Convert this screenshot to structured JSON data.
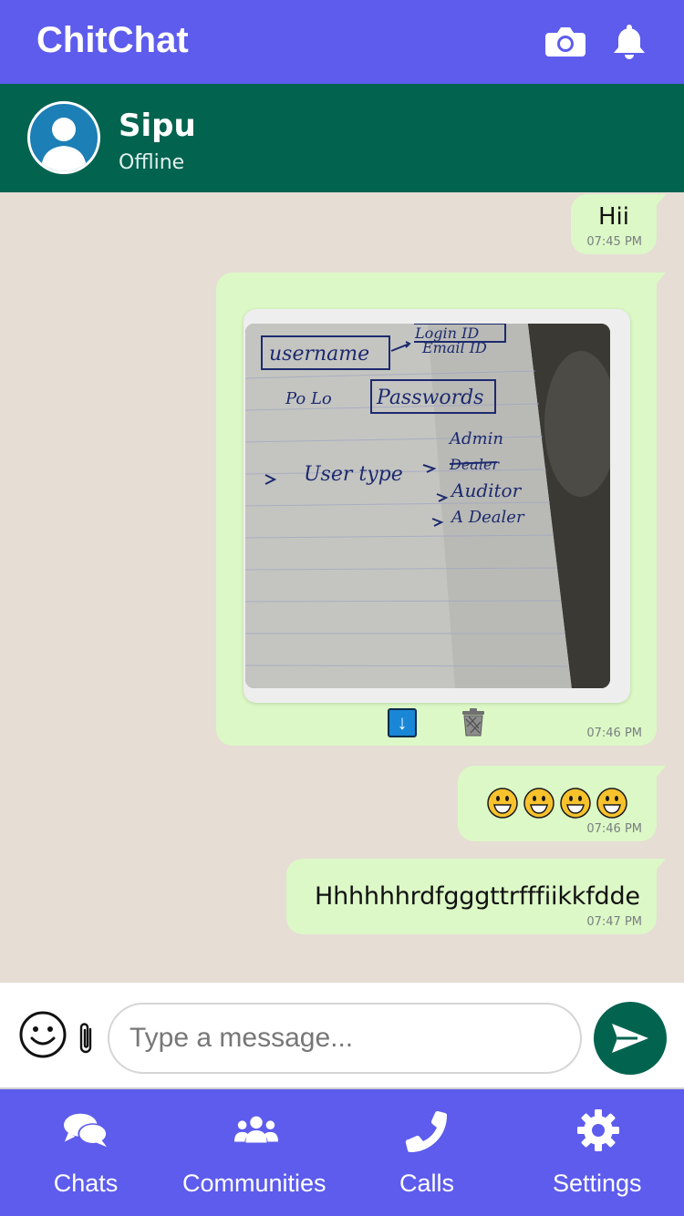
{
  "app": {
    "title": "ChitChat"
  },
  "topbar": {
    "icons": [
      "camera-icon",
      "bell-icon"
    ]
  },
  "contact": {
    "name": "Sipu",
    "status": "Offline"
  },
  "messages": [
    {
      "type": "text",
      "text": "Hii",
      "time": "07:45 PM"
    },
    {
      "type": "image",
      "time": "07:46 PM",
      "actions": [
        "download-icon",
        "trash-icon"
      ],
      "download_glyph": "↓"
    },
    {
      "type": "emoji",
      "emoji_count": 4,
      "time": "07:46 PM"
    },
    {
      "type": "text",
      "text": "Hhhhhhrdfgggttrfffiikkfdde",
      "time": "07:47 PM"
    }
  ],
  "composer": {
    "placeholder": "Type a message...",
    "value": ""
  },
  "nav": {
    "items": [
      {
        "label": "Chats",
        "icon": "chats-icon"
      },
      {
        "label": "Communities",
        "icon": "communities-icon"
      },
      {
        "label": "Calls",
        "icon": "phone-icon"
      },
      {
        "label": "Settings",
        "icon": "gear-icon"
      }
    ]
  },
  "colors": {
    "brand": "#5d5ced",
    "header": "#02634f",
    "bubble": "#dcf8c6",
    "background": "#e6ddd4"
  }
}
